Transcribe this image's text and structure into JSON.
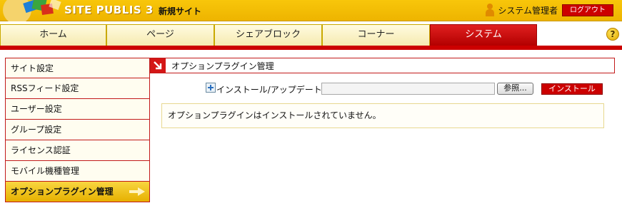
{
  "header": {
    "logo_text": "SITE PUBLIS 3",
    "site_name": "新規サイト",
    "user_name": "システム管理者",
    "logout_label": "ログアウト"
  },
  "nav": {
    "tabs": [
      {
        "label": "ホーム",
        "active": false
      },
      {
        "label": "ページ",
        "active": false
      },
      {
        "label": "シェアブロック",
        "active": false
      },
      {
        "label": "コーナー",
        "active": false
      },
      {
        "label": "システム",
        "active": true
      }
    ],
    "help_label": "?"
  },
  "sidebar": {
    "items": [
      {
        "label": "サイト設定",
        "active": false
      },
      {
        "label": "RSSフィード設定",
        "active": false
      },
      {
        "label": "ユーザー設定",
        "active": false
      },
      {
        "label": "グループ設定",
        "active": false
      },
      {
        "label": "ライセンス認証",
        "active": false
      },
      {
        "label": "モバイル機種管理",
        "active": false
      },
      {
        "label": "オプションプラグイン管理",
        "active": true
      }
    ]
  },
  "main": {
    "title": "オプションプラグイン管理",
    "install_label": "インストール/アップデート",
    "file_value": "",
    "browse_label": "参照...",
    "install_button": "インストール",
    "message": "オプションプラグインはインストールされていません。"
  },
  "colors": {
    "header_yellow": "#f3bd05",
    "accent_red": "#cc0000",
    "active_side": "#f0c420"
  }
}
